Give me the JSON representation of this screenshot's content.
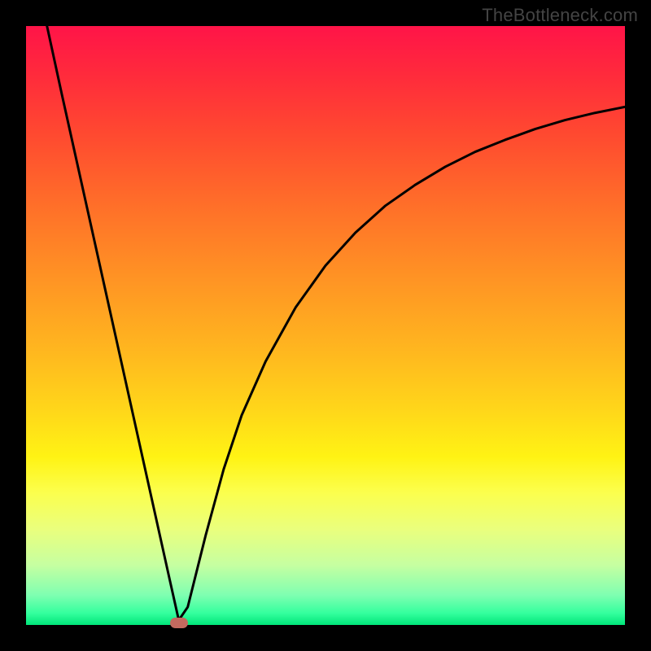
{
  "watermark": "TheBottleneck.com",
  "chart_data": {
    "type": "line",
    "title": "",
    "xlabel": "",
    "ylabel": "",
    "xlim": [
      0,
      100
    ],
    "ylim": [
      0,
      100
    ],
    "grid": false,
    "series": [
      {
        "name": "curve",
        "x": [
          3.5,
          6,
          9,
          12,
          15,
          18,
          21,
          24,
          25.5,
          27,
          30,
          33,
          36,
          40,
          45,
          50,
          55,
          60,
          65,
          70,
          75,
          80,
          85,
          90,
          95,
          100
        ],
        "y": [
          100,
          88.5,
          75,
          61.5,
          48,
          34.5,
          21,
          7.5,
          0.8,
          3,
          15,
          26,
          35,
          44,
          53,
          60,
          65.5,
          70,
          73.5,
          76.5,
          79,
          81,
          82.8,
          84.3,
          85.5,
          86.5
        ]
      }
    ],
    "marker": {
      "x": 25.5,
      "y": 0.3,
      "color": "#c46a5f"
    },
    "gradient_stops": [
      {
        "pos": 0,
        "color": "#ff1448"
      },
      {
        "pos": 50,
        "color": "#ffb020"
      },
      {
        "pos": 75,
        "color": "#fff314"
      },
      {
        "pos": 100,
        "color": "#00e67a"
      }
    ]
  }
}
